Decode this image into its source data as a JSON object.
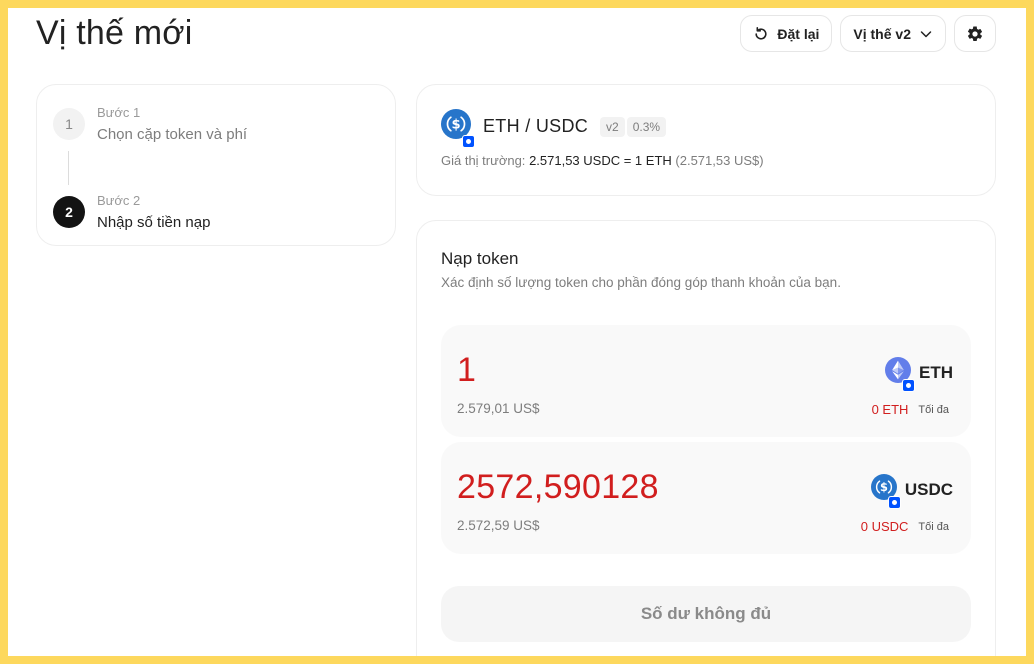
{
  "page": {
    "title": "Vị thế mới"
  },
  "toolbar": {
    "reset_label": "Đặt lại",
    "version_label": "Vị thế v2",
    "reset_icon": "refresh-icon",
    "version_icon": "chevron-down-icon",
    "settings_icon": "gear-icon"
  },
  "steps": [
    {
      "number": "1",
      "caption": "Bước 1",
      "label": "Chọn cặp token và phí"
    },
    {
      "number": "2",
      "caption": "Bước 2",
      "label": "Nhập số tiền nạp"
    }
  ],
  "pair": {
    "token_a": "ETH",
    "separator": "/",
    "token_b": "USDC",
    "version_tag": "v2",
    "fee_tag": "0.3%",
    "market_price_label": "Giá thị trường:",
    "market_price_value": "2.571,53 USDC = 1 ETH",
    "market_price_usd": "(2.571,53 US$)"
  },
  "deposit": {
    "title": "Nạp token",
    "description": "Xác định số lượng token cho phần đóng góp thanh khoản của bạn.",
    "tokens": [
      {
        "amount": "1",
        "usd_value": "2.579,01 US$",
        "symbol": "ETH",
        "balance": "0 ETH",
        "max_label": "Tối đa"
      },
      {
        "amount": "2572,590128",
        "usd_value": "2.572,59 US$",
        "symbol": "USDC",
        "balance": "0 USDC",
        "max_label": "Tối đa"
      }
    ],
    "submit_label": "Số dư không đủ"
  },
  "colors": {
    "background_frame": "#fdd85d",
    "error_red": "#d11e1e",
    "usdc_blue": "#2775ca",
    "eth_blue": "#627eea",
    "chain_badge": "#0052ff"
  }
}
